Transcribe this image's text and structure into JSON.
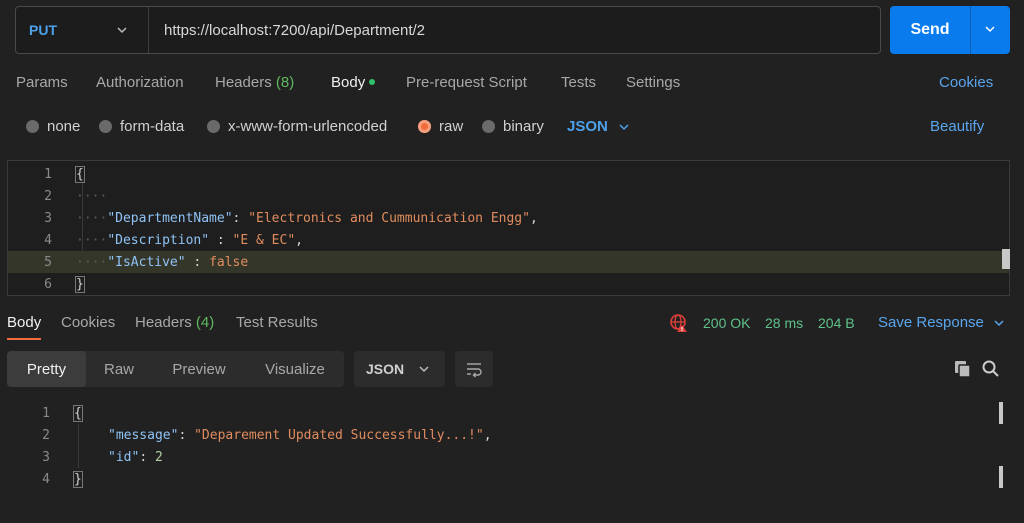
{
  "request": {
    "method": "PUT",
    "url": "https://localhost:7200/api/Department/2",
    "send_label": "Send"
  },
  "tabs": {
    "params": "Params",
    "authorization": "Authorization",
    "headers": "Headers",
    "headers_count": "(8)",
    "body": "Body",
    "prerequest": "Pre-request Script",
    "tests": "Tests",
    "settings": "Settings",
    "cookies": "Cookies"
  },
  "body_types": {
    "none": "none",
    "form_data": "form-data",
    "urlencoded": "x-www-form-urlencoded",
    "raw": "raw",
    "binary": "binary",
    "format": "JSON",
    "beautify": "Beautify"
  },
  "editor": {
    "line_numbers": [
      "1",
      "2",
      "3",
      "4",
      "5",
      "6"
    ],
    "open_brace": "{",
    "close_brace": "}",
    "ws2": "····",
    "ws3": "····",
    "ws4": "····",
    "ws5": "····",
    "key1": "\"DepartmentName\"",
    "sep1": ": ",
    "val1": "\"Electronics and Cummunication Engg\"",
    "key2": "\"Description\"",
    "sep2": " : ",
    "val2": "\"E & EC\"",
    "key3": "\"IsActive\"",
    "sep3": " : ",
    "val3": "false",
    "comma": ","
  },
  "response": {
    "tabs": {
      "body": "Body",
      "cookies": "Cookies",
      "headers": "Headers",
      "headers_count": "(4)",
      "test_results": "Test Results"
    },
    "status": "200 OK",
    "time": "28 ms",
    "size": "204 B",
    "save_response": "Save Response",
    "views": {
      "pretty": "Pretty",
      "raw": "Raw",
      "preview": "Preview",
      "visualize": "Visualize"
    },
    "format": "JSON",
    "line_numbers": [
      "1",
      "2",
      "3",
      "4"
    ],
    "open_brace": "{",
    "close_brace": "}",
    "key1": "\"message\"",
    "val1": "\"Deparement Updated Successfully...!\"",
    "key2": "\"id\"",
    "val2": "2",
    "colon": ": ",
    "comma": ","
  },
  "colors": {
    "accent": "#097bed",
    "method": "#4da0ea",
    "radio_active": "#f26b3a",
    "status_ok": "#5fc18a"
  }
}
